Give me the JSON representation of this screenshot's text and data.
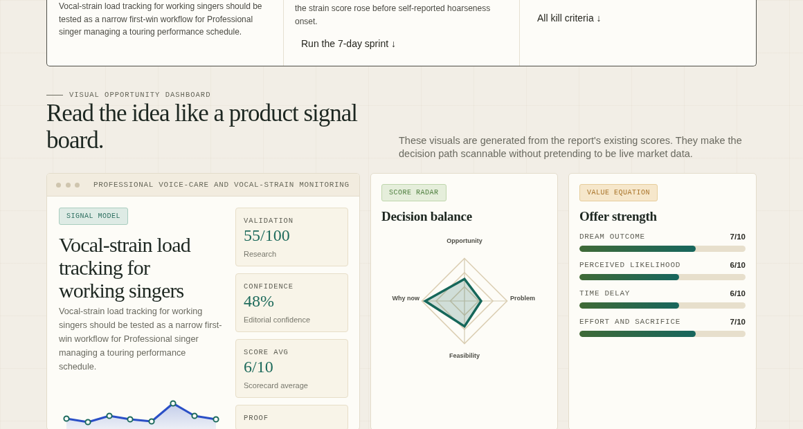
{
  "summary_card": {
    "columns": [
      {
        "text": "Vocal-strain load tracking for working singers should be tested as a narrow first-win workflow for Professional singer managing a touring performance schedule."
      },
      {
        "text": "the strain score rose before self-reported hoarseness onset.",
        "link": "Run the 7-day sprint ↓"
      },
      {
        "link": "All kill criteria ↓"
      }
    ]
  },
  "dashboard": {
    "eyebrow": "VISUAL OPPORTUNITY DASHBOARD",
    "title": "Read the idea like a product signal board.",
    "intro": "These visuals are generated from the report's existing scores. They make the decision path scannable without pretending to be live market data."
  },
  "signal_card": {
    "window_title": "PROFESSIONAL VOICE-CARE AND VOCAL-STRAIN MONITORING",
    "tag": "SIGNAL MODEL",
    "title": "Vocal-strain load tracking for working singers",
    "description": "Vocal-strain load tracking for working singers should be tested as a narrow first-win workflow for Professional singer managing a touring performance schedule.",
    "metrics": [
      {
        "label": "VALIDATION",
        "value": "55/100",
        "caption": "Research"
      },
      {
        "label": "CONFIDENCE",
        "value": "48%",
        "caption": "Editorial confidence"
      },
      {
        "label": "SCORE AVG",
        "value": "6/10",
        "caption": "Scorecard average"
      },
      {
        "label": "PROOF"
      }
    ]
  },
  "radar_card": {
    "tag": "SCORE RADAR",
    "title": "Decision balance",
    "axes": [
      "Opportunity",
      "Problem",
      "Feasibility",
      "Why now"
    ]
  },
  "offer_card": {
    "tag": "VALUE EQUATION",
    "title": "Offer strength",
    "factors": [
      {
        "label": "DREAM OUTCOME",
        "reading": "7/10",
        "level": 0.7
      },
      {
        "label": "PERCEIVED LIKELIHOOD",
        "reading": "6/10",
        "level": 0.6
      },
      {
        "label": "TIME DELAY",
        "reading": "6/10",
        "level": 0.6
      },
      {
        "label": "EFFORT AND SACRIFICE",
        "reading": "7/10",
        "level": 0.7
      }
    ]
  }
}
